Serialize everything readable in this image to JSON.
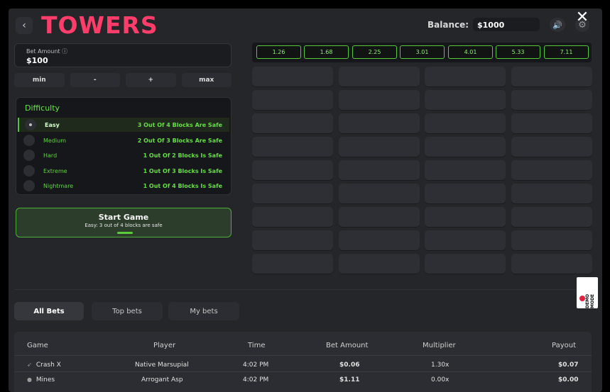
{
  "header": {
    "title": "TOWERS",
    "back_icon": "‹",
    "balance_label": "Balance:",
    "balance_value": "$1000",
    "sound_icon": "🔊",
    "gear_icon": "⚙",
    "close_icon": "✕"
  },
  "bet": {
    "label": "Bet Amount ⓘ",
    "value": "$100",
    "controls": [
      "min",
      "-",
      "+",
      "max"
    ]
  },
  "difficulty": {
    "title": "Difficulty",
    "selected": "Easy",
    "options": [
      {
        "name": "Easy",
        "desc": "3 Out Of 4 Blocks Are Safe"
      },
      {
        "name": "Medium",
        "desc": "2 Out Of 3 Blocks Are Safe"
      },
      {
        "name": "Hard",
        "desc": "1 Out Of 2 Blocks Is Safe"
      },
      {
        "name": "Extreme",
        "desc": "1 Out Of 3 Blocks Is Safe"
      },
      {
        "name": "Nightmare",
        "desc": "1 Out Of 4 Blocks Is Safe"
      }
    ]
  },
  "start": {
    "title": "Start Game",
    "subtitle": "Easy: 3 out of 4 blocks are safe"
  },
  "multipliers": [
    "1.26",
    "1.68",
    "2.25",
    "3.01",
    "4.01",
    "5.33",
    "7.11"
  ],
  "grid": {
    "rows": 9,
    "cols": 4
  },
  "demo_badge": "DEMO MODE",
  "tabs": [
    {
      "label": "All Bets",
      "active": true
    },
    {
      "label": "Top bets",
      "active": false
    },
    {
      "label": "My bets",
      "active": false
    }
  ],
  "table": {
    "headers": [
      "Game",
      "Player",
      "Time",
      "Bet Amount",
      "Multiplier",
      "Payout"
    ],
    "rows": [
      {
        "game": "Crash X",
        "player": "Native Marsupial",
        "time": "4:02 PM",
        "bet": "$0.06",
        "multiplier": "1.30x",
        "payout": "$0.07"
      },
      {
        "game": "Mines",
        "player": "Arrogant Asp",
        "time": "4:02 PM",
        "bet": "$1.11",
        "multiplier": "0.00x",
        "payout": "$0.00"
      }
    ]
  },
  "colors": {
    "title": "#ff3c6a",
    "accent_green": "#5ccc3a"
  }
}
